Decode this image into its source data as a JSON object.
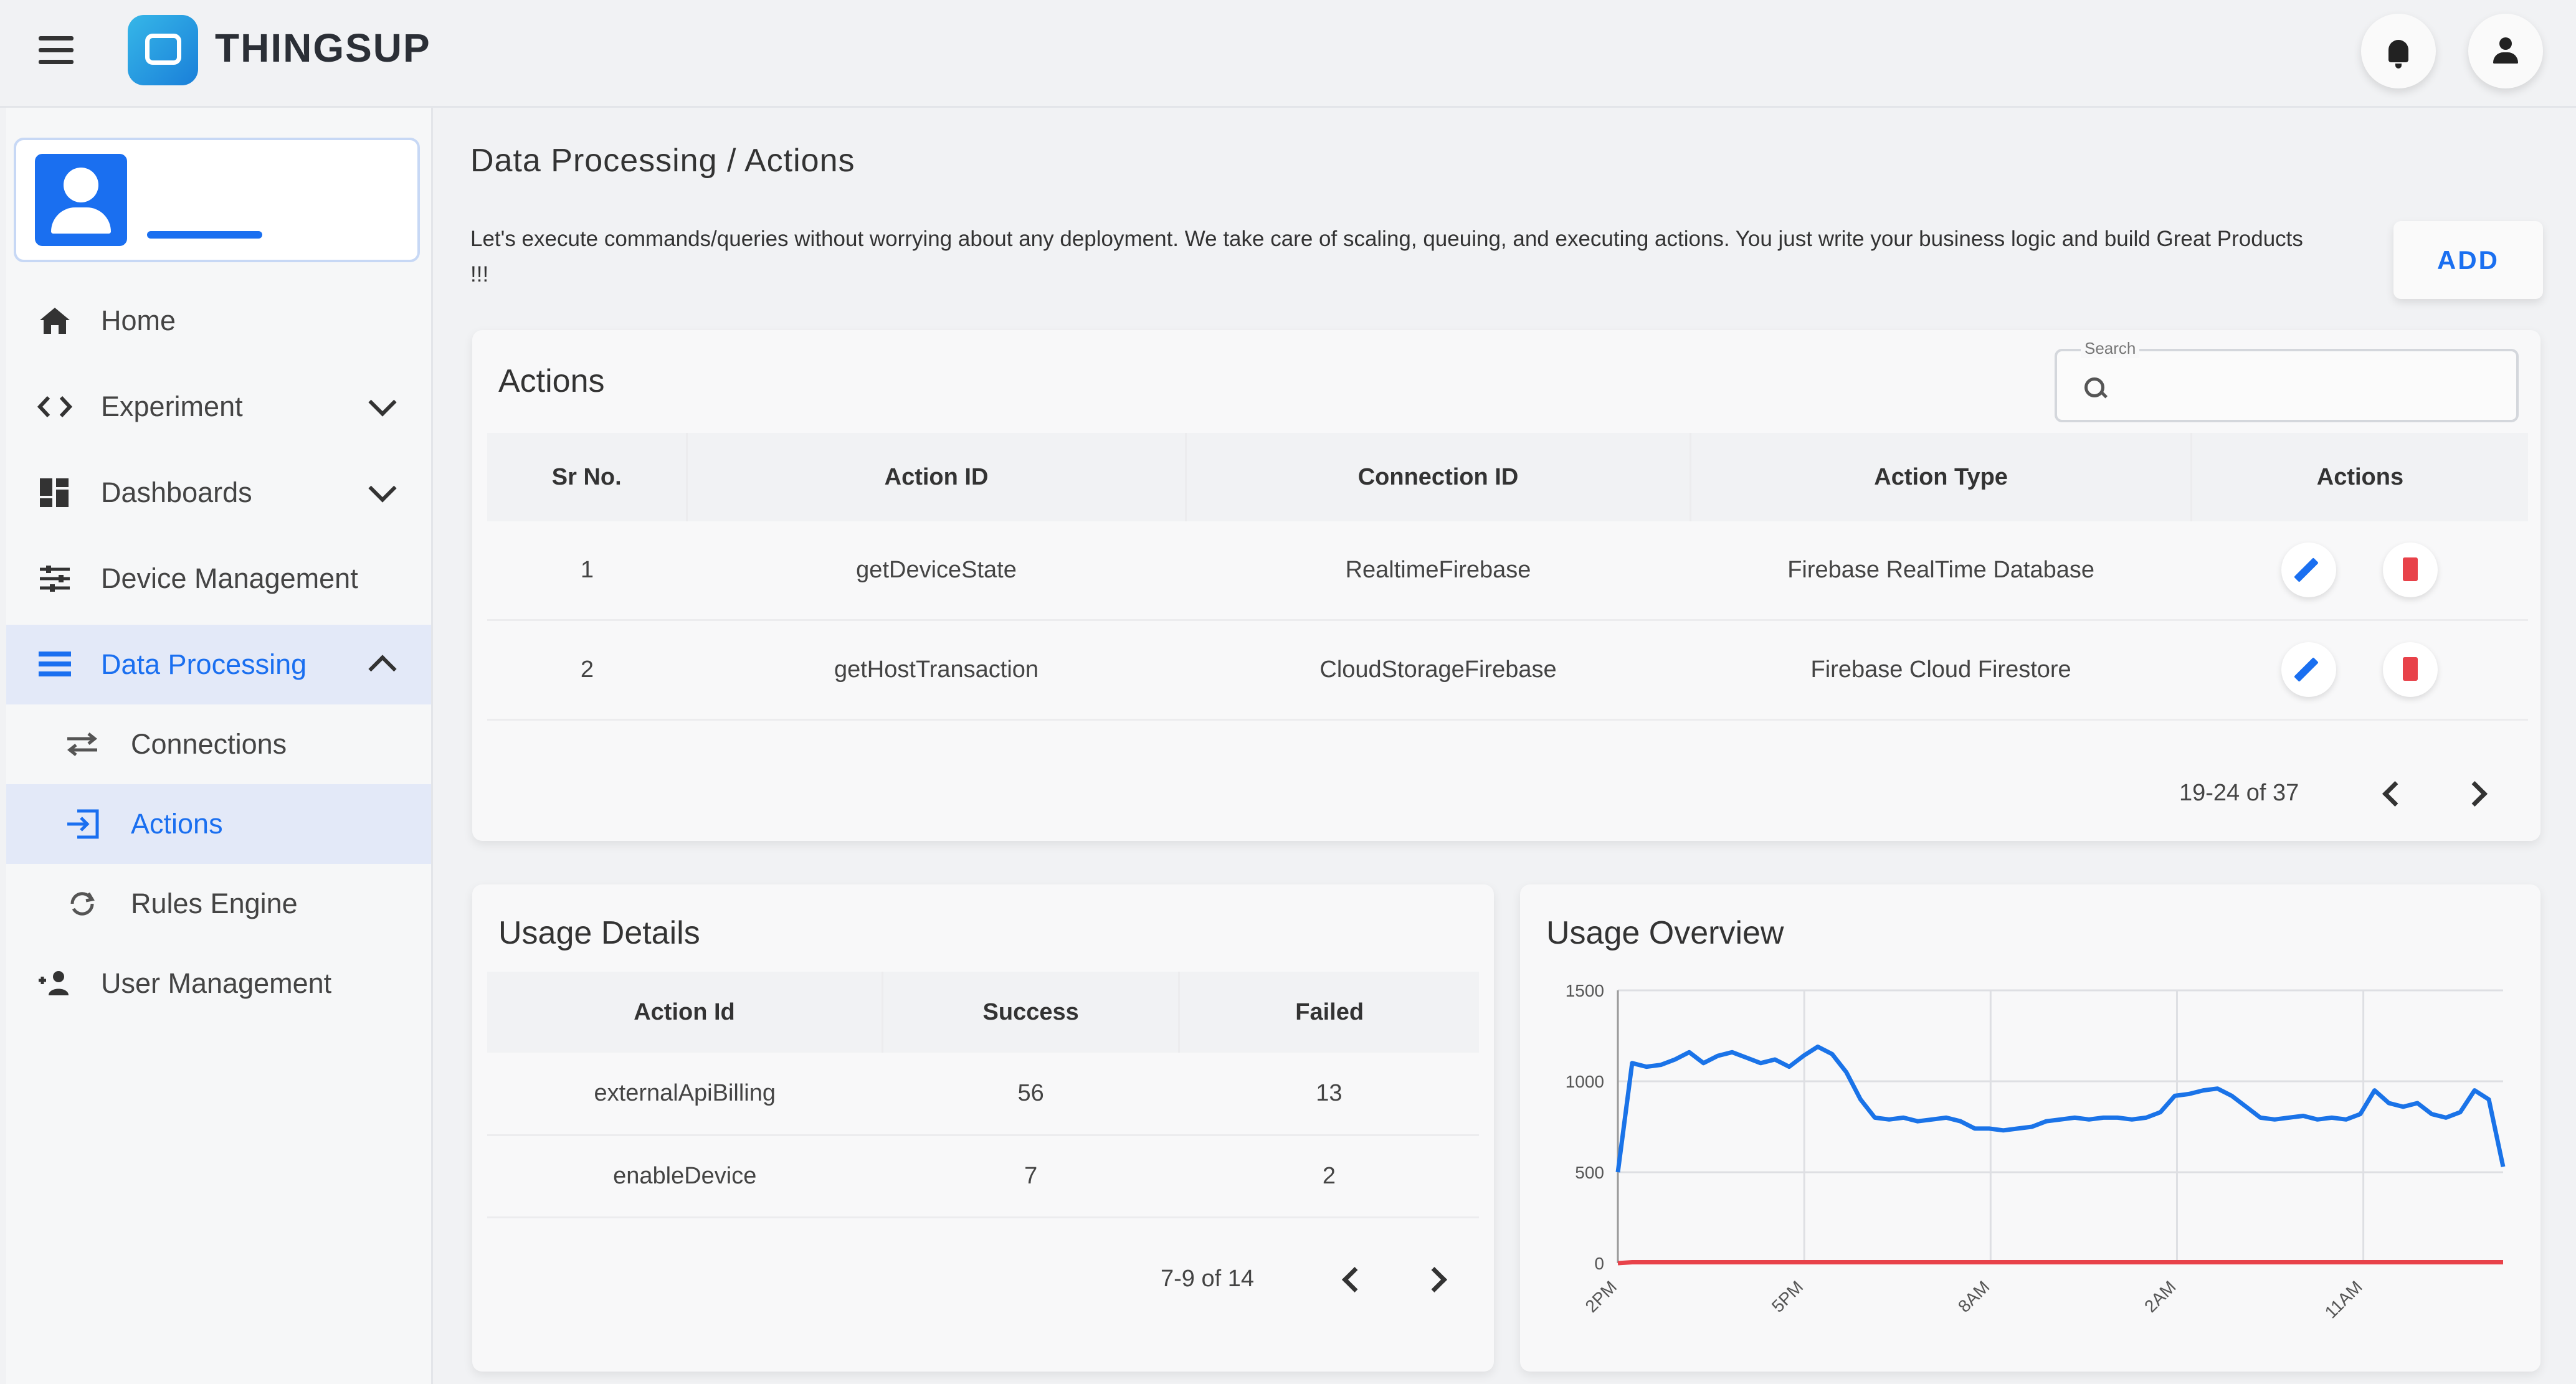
{
  "app": {
    "brand": "THINGSUP"
  },
  "sidebar": {
    "items": [
      {
        "label": "Home"
      },
      {
        "label": "Experiment"
      },
      {
        "label": "Dashboards"
      },
      {
        "label": "Device Management"
      },
      {
        "label": "Data Processing"
      },
      {
        "label": "Connections"
      },
      {
        "label": "Actions"
      },
      {
        "label": "Rules Engine"
      },
      {
        "label": "User Management"
      }
    ]
  },
  "breadcrumb": "Data Processing / Actions",
  "description": "Let's execute commands/queries without worrying about any deployment. We take care of scaling, queuing, and executing actions. You just write your business logic and build Great Products !!!",
  "add_label": "ADD",
  "actions_card": {
    "title": "Actions",
    "search_label": "Search",
    "columns": [
      "Sr No.",
      "Action ID",
      "Connection ID",
      "Action Type",
      "Actions"
    ],
    "rows": [
      {
        "sr": "1",
        "action_id": "getDeviceState",
        "connection_id": "RealtimeFirebase",
        "action_type": "Firebase RealTime Database"
      },
      {
        "sr": "2",
        "action_id": "getHostTransaction",
        "connection_id": "CloudStorageFirebase",
        "action_type": "Firebase Cloud Firestore"
      }
    ],
    "pagination": "19-24 of 37"
  },
  "usage_details": {
    "title": "Usage Details",
    "columns": [
      "Action Id",
      "Success",
      "Failed"
    ],
    "rows": [
      {
        "action_id": "externalApiBilling",
        "success": "56",
        "failed": "13"
      },
      {
        "action_id": "enableDevice",
        "success": "7",
        "failed": "2"
      }
    ],
    "pagination": "7-9 of 14"
  },
  "chart_data": {
    "type": "line",
    "title": "Usage Overview",
    "ylim": [
      0,
      1500
    ],
    "yticks": [
      0,
      500,
      1000,
      1500
    ],
    "xticks": [
      "2PM",
      "5PM",
      "8AM",
      "2AM",
      "11AM"
    ],
    "grid": true,
    "series": [
      {
        "color": "#1a73e8",
        "values": [
          500,
          1100,
          1080,
          1090,
          1120,
          1160,
          1100,
          1140,
          1160,
          1130,
          1100,
          1120,
          1080,
          1140,
          1190,
          1150,
          1050,
          900,
          800,
          790,
          800,
          780,
          790,
          800,
          780,
          740,
          740,
          730,
          740,
          750,
          780,
          790,
          800,
          790,
          800,
          800,
          790,
          800,
          830,
          920,
          930,
          950,
          960,
          920,
          860,
          800,
          790,
          800,
          810,
          790,
          800,
          790,
          820,
          950,
          880,
          860,
          880,
          820,
          800,
          830,
          950,
          900,
          530
        ]
      },
      {
        "color": "#e8424a",
        "values": [
          0,
          5,
          5,
          5,
          5,
          5,
          5,
          5,
          5,
          5,
          5,
          5,
          5,
          5,
          5,
          5,
          5,
          5,
          5,
          5,
          5,
          5,
          5,
          5,
          5,
          5,
          5,
          5,
          5,
          5,
          5,
          5,
          5,
          5,
          5,
          5,
          5,
          5,
          5,
          5,
          5,
          5,
          5,
          5,
          5,
          5,
          5,
          5,
          5,
          5,
          5,
          5,
          5,
          5,
          5,
          5,
          5,
          5,
          5,
          5,
          5,
          5,
          5
        ]
      }
    ]
  }
}
